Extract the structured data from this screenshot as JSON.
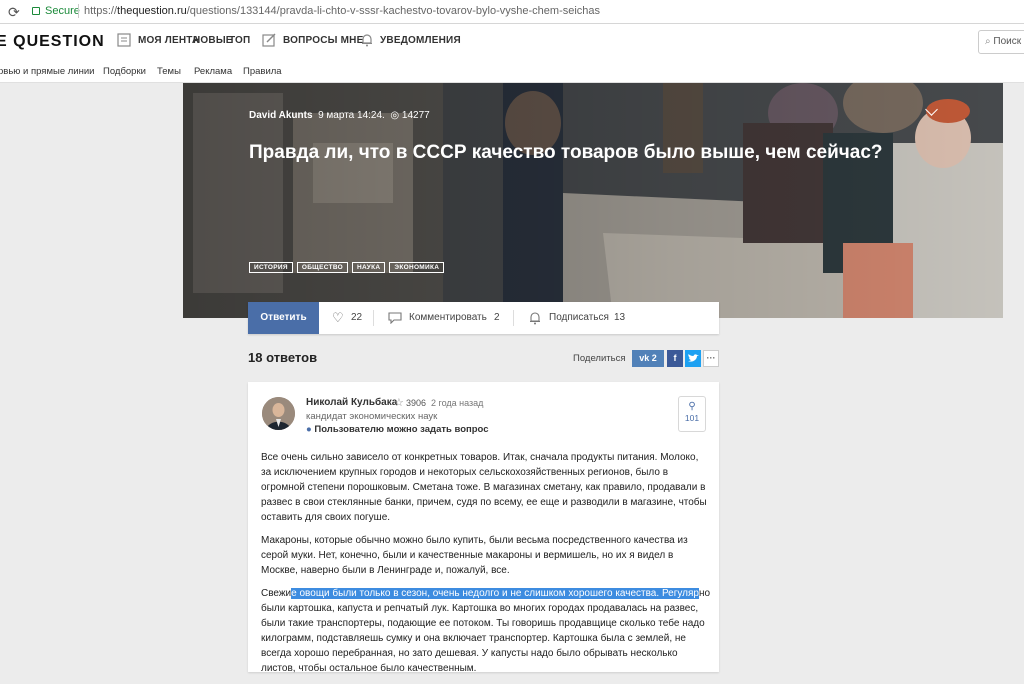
{
  "browser": {
    "secure_label": "Secure",
    "url_scheme": "https://",
    "url_host": "thequestion.ru",
    "url_path": "/questions/133144/pravda-li-chto-v-sssr-kachestvo-tovarov-bylo-vyshe-chem-seichas"
  },
  "header": {
    "logo": "E QUESTION",
    "nav": [
      "МОЯ ЛЕНТА",
      "НОВЫЕ",
      "ТОП"
    ],
    "ask": "ВОПРОСЫ МНЕ",
    "notifications": "УВЕДОМЛЕНИЯ",
    "search_placeholder": "Поиск"
  },
  "subnav": [
    "рвью и прямые линии",
    "Подборки",
    "Темы",
    "Реклама",
    "Правила"
  ],
  "question": {
    "author": "David Akunts",
    "date": "9 марта 14:24.",
    "views": "14277",
    "title": "Правда ли, что в СССР качество товаров было выше, чем сейчас?",
    "tags": [
      "ИСТОРИЯ",
      "ОБЩЕСТВО",
      "НАУКА",
      "ЭКОНОМИКА"
    ]
  },
  "actions": {
    "answer": "Ответить",
    "likes": "22",
    "comment": "Комментировать",
    "comments": "2",
    "subscribe": "Подписаться",
    "subscribers": "13"
  },
  "answers_header": {
    "count_label": "18 ответов",
    "share_label": "Поделиться",
    "vk_count": "2",
    "vk": "vk",
    "fb": "f",
    "more": "···"
  },
  "answer": {
    "author": "Николай Кульбака",
    "rating": "3906",
    "time": "2 года назад",
    "role": "кандидат экономических наук",
    "ask_link": "Пользователю можно задать вопрос",
    "subscribers": "101",
    "p1": "Все очень сильно зависело от конкретных товаров. Итак, сначала продукты питания. Молоко, за исключением крупных городов и некоторых сельскохозяйственных регионов, было в огромной степени порошковым. Сметана тоже. В магазинах сметану, как правило, продавали в развес в свои стеклянные банки, причем, судя по всему, ее еще и разводили в магазине, чтобы оставить для своих погуше.",
    "p2": "Макароны, которые обычно можно было купить, были весьма посредственного качества из серой муки. Нет, конечно, были и качественные макароны и вермишель, но их  я видел в Москве, наверно были в Ленинграде и, пожалуй, все.",
    "p3_pre": "Свежи",
    "p3_hl1": "е овощи были только в сезон, очень недолго и не слишком хорошего качества. ",
    "p3_hl2": "Регуляр",
    "p3_post": "но были картошка, капуста и репчатый лук. Картошка во многих городах продавалась на развес, были такие транспортеры, подающие ее потоком. Ты говоришь продавщице сколько тебе надо килограмм, подставляешь сумку и она включает транспортер. Картошка была с землей, не всегда хорошо перебранная, но зато дешевая. У капусты надо было обрывать несколько листов, чтобы остальное было качественным."
  }
}
